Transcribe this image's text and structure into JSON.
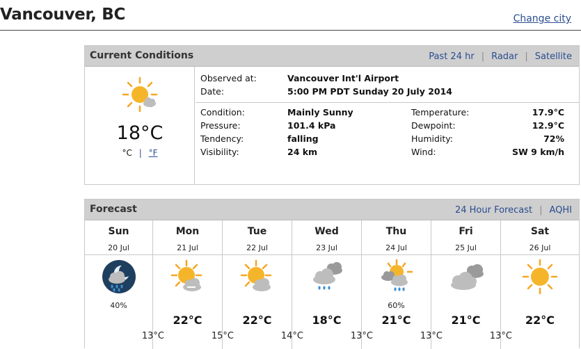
{
  "page": {
    "city": "Vancouver, BC",
    "change_city": "Change city"
  },
  "current": {
    "title": "Current Conditions",
    "links": [
      "Past 24 hr",
      "Radar",
      "Satellite"
    ],
    "icon": "sun-with-small-cloud-icon",
    "temperature": "18°C",
    "unit_c": "°C",
    "unit_sep": "|",
    "unit_f": "°F",
    "observed_label": "Observed at:",
    "observed_value": "Vancouver Int'l Airport",
    "date_label": "Date:",
    "date_value": "5:00 PM PDT Sunday 20 July 2014",
    "condition_label": "Condition:",
    "condition_value": "Mainly Sunny",
    "pressure_label": "Pressure:",
    "pressure_value": "101.4 kPa",
    "tendency_label": "Tendency:",
    "tendency_value": "falling",
    "visibility_label": "Visibility:",
    "visibility_value": "24 km",
    "temperature_label": "Temperature:",
    "temperature_value": "17.9°C",
    "dewpoint_label": "Dewpoint:",
    "dewpoint_value": "12.9°C",
    "humidity_label": "Humidity:",
    "humidity_value": "72%",
    "wind_label": "Wind:",
    "wind_value": "SW 9 km/h"
  },
  "forecast": {
    "title": "Forecast",
    "links": [
      "24 Hour Forecast",
      "AQHI"
    ],
    "days": [
      {
        "day": "Sun",
        "date": "20 Jul",
        "icon": "night-cloud-rain-icon",
        "pop": "40%",
        "high": "",
        "low": "13°C"
      },
      {
        "day": "Mon",
        "date": "21 Jul",
        "icon": "sun-cloud-haze-icon",
        "pop": "",
        "high": "22°C",
        "low": "15°C"
      },
      {
        "day": "Tue",
        "date": "22 Jul",
        "icon": "sun-cloud-icon",
        "pop": "",
        "high": "22°C",
        "low": "14°C"
      },
      {
        "day": "Wed",
        "date": "23 Jul",
        "icon": "cloud-rain-icon",
        "pop": "",
        "high": "18°C",
        "low": "13°C"
      },
      {
        "day": "Thu",
        "date": "24 Jul",
        "icon": "sun-cloud-rain-icon",
        "pop": "60%",
        "high": "21°C",
        "low": "13°C"
      },
      {
        "day": "Fri",
        "date": "25 Jul",
        "icon": "cloudy-icon",
        "pop": "",
        "high": "21°C",
        "low": "13°C"
      },
      {
        "day": "Sat",
        "date": "26 Jul",
        "icon": "sun-icon",
        "pop": "",
        "high": "22°C",
        "low": ""
      }
    ]
  },
  "colors": {
    "link": "#2a4d8f",
    "panel_header": "#cfcfcf",
    "sun": "#f5a623",
    "cloud": "#b5b5b5",
    "rain": "#3a8fd6",
    "night_bg": "#1f3f5f"
  }
}
